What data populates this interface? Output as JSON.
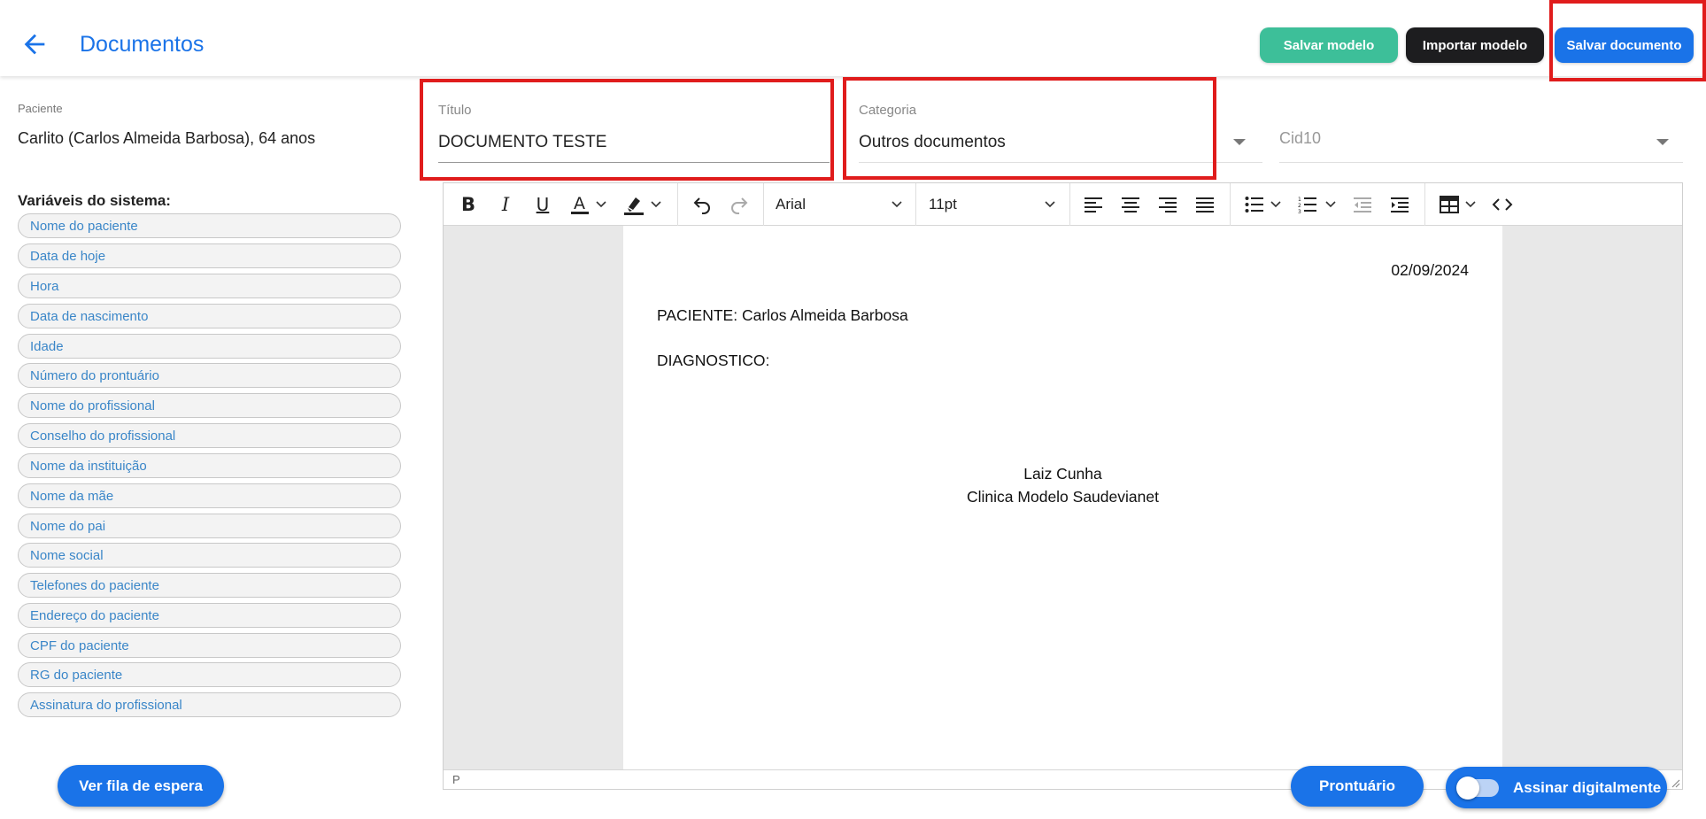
{
  "header": {
    "title": "Documentos",
    "buttons": {
      "save_model": "Salvar modelo",
      "import_model": "Importar modelo",
      "save_document": "Salvar documento"
    }
  },
  "patient": {
    "label": "Paciente",
    "name": "Carlito (Carlos Almeida Barbosa), 64 anos"
  },
  "system_variables": {
    "title": "Variáveis do sistema:",
    "items": [
      "Nome do paciente",
      "Data de hoje",
      "Hora",
      "Data de nascimento",
      "Idade",
      "Número do prontuário",
      "Nome do profissional",
      "Conselho do profissional",
      "Nome da instituição",
      "Nome da mãe",
      "Nome do pai",
      "Nome social",
      "Telefones do paciente",
      "Endereço do paciente",
      "CPF do paciente",
      "RG do paciente",
      "Assinatura do profissional"
    ]
  },
  "form": {
    "title_label": "Título",
    "title_value": "DOCUMENTO TESTE",
    "category_label": "Categoria",
    "category_value": "Outros documentos",
    "cid_placeholder": "Cid10"
  },
  "editor": {
    "font_family": "Arial",
    "font_size": "11pt",
    "status_path": "P",
    "content": {
      "date": "02/09/2024",
      "patient_line": "PACIENTE: Carlos Almeida Barbosa",
      "diagnosis_line": "DIAGNOSTICO:",
      "signature_name": "Laiz Cunha",
      "signature_clinic": "Clinica Modelo Saudevianet"
    }
  },
  "footer": {
    "waitlist": "Ver fila de espera",
    "record": "Prontuário",
    "sign_digitally": "Assinar digitalmente",
    "sign_toggle_on": false
  },
  "colors": {
    "primary": "#1a73e8",
    "green": "#3dbf99",
    "dark": "#1d1d1f",
    "highlight": "#e01c1c"
  }
}
